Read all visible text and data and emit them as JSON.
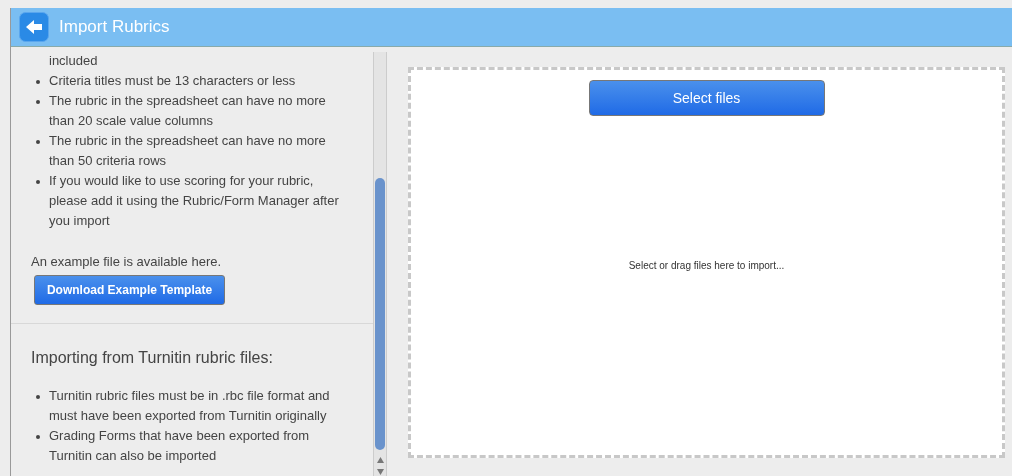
{
  "header": {
    "title": "Import Rubrics"
  },
  "left_panel": {
    "list_top": [
      "included",
      "Criteria titles must be 13 characters or less",
      "The rubric in the spreadsheet can have no more than 20 scale value columns",
      "The rubric in the spreadsheet can have no more than 50 criteria rows",
      "If you would like to use scoring for your rubric, please add it using the Rubric/Form Manager after you import"
    ],
    "example_note": "An example file is available here.",
    "download_button": "Download Example Template",
    "turnitin_heading": "Importing from Turnitin rubric files:",
    "list_bottom": [
      "Turnitin rubric files must be in .rbc file format and must have been exported from Turnitin originally",
      "Grading Forms that have been exported from Turnitin can also be imported"
    ]
  },
  "drop_zone": {
    "select_button": "Select files",
    "hint": "Select or drag files here to import..."
  }
}
